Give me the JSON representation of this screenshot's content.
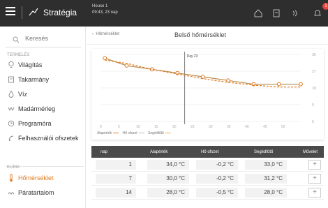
{
  "topbar": {
    "app_title": "Stratégia",
    "house_name": "House 1",
    "house_time": "09:43, 23 nap",
    "badge_count": "1"
  },
  "sidebar": {
    "search_placeholder": "Keresés",
    "section_termeles": "TERMELÉS",
    "section_klima": "KLÍMA",
    "items": [
      {
        "label": "Világítás",
        "icon": "bulb-icon"
      },
      {
        "label": "Takarmány",
        "icon": "feed-icon"
      },
      {
        "label": "Víz",
        "icon": "water-drop-icon"
      },
      {
        "label": "Madármérleg",
        "icon": "scale-icon"
      },
      {
        "label": "Programóra",
        "icon": "clock-icon"
      },
      {
        "label": "Felhasználói ofszetek",
        "icon": "offset-icon"
      },
      {
        "label": "Hőmérséklet",
        "icon": "thermometer-icon"
      },
      {
        "label": "Páratartalom",
        "icon": "humidity-icon"
      }
    ]
  },
  "main": {
    "back_link": "Hőmérséklet",
    "title": "Belső hőmérséklet",
    "legend": [
      "Alapérték",
      "Hő ofszet",
      "Segédfűtő"
    ]
  },
  "chart_data": {
    "type": "line",
    "x_ticks": [
      "0",
      "5",
      "10",
      "15",
      "20",
      "25",
      "30",
      "35",
      "40",
      "45",
      "50"
    ],
    "y_ticks": [
      "0",
      "9",
      "18",
      "27",
      "36"
    ],
    "xlim": [
      0,
      55
    ],
    "ylim": [
      0,
      36
    ],
    "marker_label": "Day 23",
    "marker_x": 23,
    "series": [
      {
        "name": "Alapérték",
        "x": [
          1,
          7,
          14,
          21,
          28,
          35,
          42,
          49,
          55
        ],
        "values": [
          34.0,
          30.0,
          28.0,
          26.0,
          24.0,
          22.0,
          20.0,
          20.0,
          20.0
        ]
      },
      {
        "name": "Segédfűtő",
        "x": [
          1,
          7,
          14,
          21,
          28,
          35,
          42,
          49,
          55
        ],
        "values": [
          33.0,
          31.2,
          28.0,
          25.5,
          23.0,
          21.0,
          19.5,
          18.5,
          18.5
        ]
      }
    ]
  },
  "table": {
    "headers": [
      "nap",
      "Alapérték",
      "Hő ofszet",
      "Segédfűtő",
      "Művelet"
    ],
    "rows": [
      {
        "day": "1",
        "base": "34,0 °C",
        "offset": "-0,2 °C",
        "heater": "33,0 °C"
      },
      {
        "day": "7",
        "base": "30,0 °C",
        "offset": "-0,2 °C",
        "heater": "31,2 °C"
      },
      {
        "day": "14",
        "base": "28,0 °C",
        "offset": "-0,5 °C",
        "heater": "28,0 °C"
      }
    ],
    "action_symbol": "+"
  },
  "colors": {
    "accent": "#e07a1e",
    "topbar": "#2e2e2e",
    "table_header": "#4a4a4a"
  }
}
